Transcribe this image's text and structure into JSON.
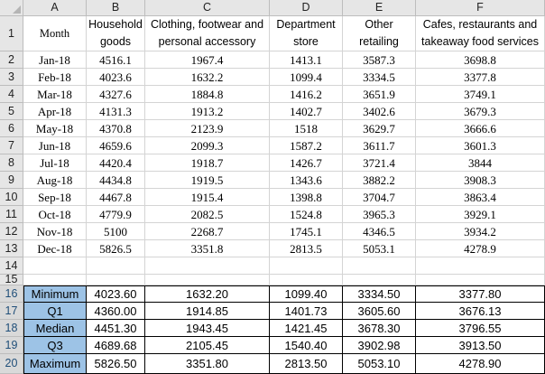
{
  "columns": [
    "A",
    "B",
    "C",
    "D",
    "E",
    "F"
  ],
  "row_numbers": [
    "1",
    "2",
    "3",
    "4",
    "5",
    "6",
    "7",
    "8",
    "9",
    "10",
    "11",
    "12",
    "13",
    "14",
    "15",
    "16",
    "17",
    "18",
    "19",
    "20"
  ],
  "headers": [
    [
      "Month"
    ],
    [
      "Household",
      "goods"
    ],
    [
      "Clothing, footwear and",
      "personal accessory"
    ],
    [
      "Department",
      "store"
    ],
    [
      "Other",
      "retailing"
    ],
    [
      "Cafes, restaurants and",
      "takeaway food services"
    ]
  ],
  "data_rows": [
    [
      "Jan-18",
      "4516.1",
      "1967.4",
      "1413.1",
      "3587.3",
      "3698.8"
    ],
    [
      "Feb-18",
      "4023.6",
      "1632.2",
      "1099.4",
      "3334.5",
      "3377.8"
    ],
    [
      "Mar-18",
      "4327.6",
      "1884.8",
      "1416.2",
      "3651.9",
      "3749.1"
    ],
    [
      "Apr-18",
      "4131.3",
      "1913.2",
      "1402.7",
      "3402.6",
      "3679.3"
    ],
    [
      "May-18",
      "4370.8",
      "2123.9",
      "1518",
      "3629.7",
      "3666.6"
    ],
    [
      "Jun-18",
      "4659.6",
      "2099.3",
      "1587.2",
      "3611.7",
      "3601.3"
    ],
    [
      "Jul-18",
      "4420.4",
      "1918.7",
      "1426.7",
      "3721.4",
      "3844"
    ],
    [
      "Aug-18",
      "4434.8",
      "1919.5",
      "1343.6",
      "3882.2",
      "3908.3"
    ],
    [
      "Sep-18",
      "4467.8",
      "1915.4",
      "1398.8",
      "3704.7",
      "3863.4"
    ],
    [
      "Oct-18",
      "4779.9",
      "2082.5",
      "1524.8",
      "3965.3",
      "3929.1"
    ],
    [
      "Nov-18",
      "5100",
      "2268.7",
      "1745.1",
      "4346.5",
      "3934.2"
    ],
    [
      "Dec-18",
      "5826.5",
      "3351.8",
      "2813.5",
      "5053.1",
      "4278.9"
    ]
  ],
  "stat_rows": [
    [
      "Minimum",
      "4023.60",
      "1632.20",
      "1099.40",
      "3334.50",
      "3377.80"
    ],
    [
      "Q1",
      "4360.00",
      "1914.85",
      "1401.73",
      "3605.60",
      "3676.13"
    ],
    [
      "Median",
      "4451.30",
      "1943.45",
      "1421.45",
      "3678.30",
      "3796.55"
    ],
    [
      "Q3",
      "4689.68",
      "2105.45",
      "1540.40",
      "3902.98",
      "3913.50"
    ],
    [
      "Maximum",
      "5826.50",
      "3351.80",
      "2813.50",
      "5053.10",
      "4278.90"
    ]
  ],
  "colors": {
    "header_bg": "#e6e6e6",
    "stat_label_bg": "#9dc3e6",
    "selected_row_number": "#1f4e79"
  }
}
